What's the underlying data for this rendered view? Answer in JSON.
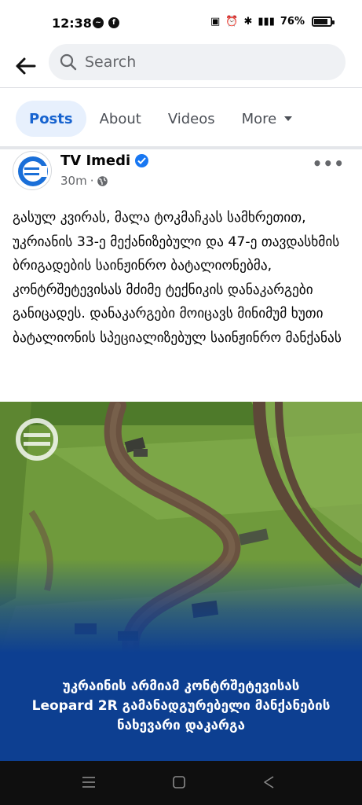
{
  "status_bar": {
    "time": "12:38",
    "battery": "76%",
    "left_icons": [
      "messenger-icon",
      "facebook-icon"
    ],
    "right_icons": [
      "nfc-icon",
      "alarm-icon",
      "bluetooth-icon",
      "signal-icon"
    ]
  },
  "search": {
    "placeholder": "Search"
  },
  "tabs": [
    {
      "label": "Posts",
      "active": true
    },
    {
      "label": "About"
    },
    {
      "label": "Videos"
    },
    {
      "label": "More"
    }
  ],
  "post": {
    "page_name": "TV Imedi",
    "time": "30m",
    "verified": true,
    "text": "გასულ კვირას, მალა ტოკმაჩკას სამხრეთით, უკრიანის 33-ე მექანიზებული და 47-ე თავდასხმის ბრიგადების საინჟინრო ბატალიონებმა, კონტრშეტევისას მძიმე ტექნიკის დანაკარგები განიცადეს. დანაკარგები მოიცავს მინიმუმ ხუთი ბატალიონის სპეციალიზებულ საინჟინრო მანქანას",
    "image": {
      "caption_line1": "უკრაინის არმიამ კონტრშეტევისას",
      "caption_line2": "Leopard 2R გამანადგურებელი მანქანების",
      "caption_line3": "ნახევარი დაკარგა",
      "overlay_color": "#0d3f91"
    }
  },
  "colors": {
    "accent": "#1763cf",
    "verified": "#1877f2"
  }
}
